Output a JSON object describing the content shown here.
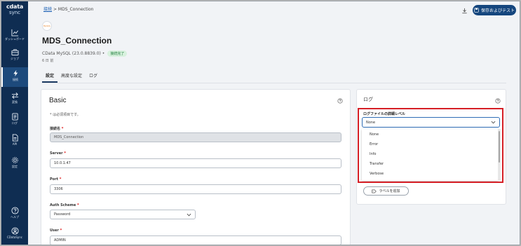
{
  "app": {
    "logo_line1": "cdata",
    "logo_line2": "sync"
  },
  "sidebar": {
    "items": [
      {
        "label": "ダッシュボード",
        "icon": "chart-line-icon"
      },
      {
        "label": "ジョブ",
        "icon": "briefcase-icon"
      },
      {
        "label": "接続",
        "icon": "lightning-icon",
        "active": true
      },
      {
        "label": "変換",
        "icon": "swap-arrows-icon"
      },
      {
        "label": "ログ",
        "icon": "log-icon"
      },
      {
        "label": "API",
        "icon": "api-file-icon"
      },
      {
        "label": "設定",
        "icon": "gear-icon"
      },
      {
        "label": "ヘルプ",
        "icon": "help-circle-icon"
      },
      {
        "label": "CDataSync",
        "icon": "user-icon"
      }
    ]
  },
  "breadcrumb": {
    "root": "接続",
    "separator": ">",
    "current": "MDS_Connection"
  },
  "toolbar": {
    "save_label": "保存およびテスト"
  },
  "connection": {
    "title": "MDS_Connection",
    "driver": "CData MySQL (23.0.8839.0)",
    "dot": "•",
    "status": "接続完了",
    "updated": "6 日 前"
  },
  "tabs": [
    "設定",
    "高度な設定",
    "ログ"
  ],
  "basic": {
    "title": "Basic",
    "required_note": "* は必須項目です。",
    "fields": [
      {
        "label": "接続名",
        "value": "MDS_Connection"
      },
      {
        "label": "Server",
        "value": "10.0.1.47"
      },
      {
        "label": "Port",
        "value": "3306"
      },
      {
        "label": "Auth Scheme",
        "value": "Password"
      },
      {
        "label": "User",
        "value": "ADMIN"
      }
    ],
    "required_star": "*"
  },
  "log": {
    "title": "ログ",
    "level_label": "ログファイルの詳細レベル",
    "selected": "None",
    "options": [
      "None",
      "Error",
      "Info",
      "Transfer",
      "Verbose"
    ],
    "add_label": "ラベルを追加"
  },
  "colors": {
    "sidebar_bg": "#0f2d52",
    "accent": "#15467e",
    "highlight": "#d61f26",
    "status_bg": "#d8f1de"
  }
}
